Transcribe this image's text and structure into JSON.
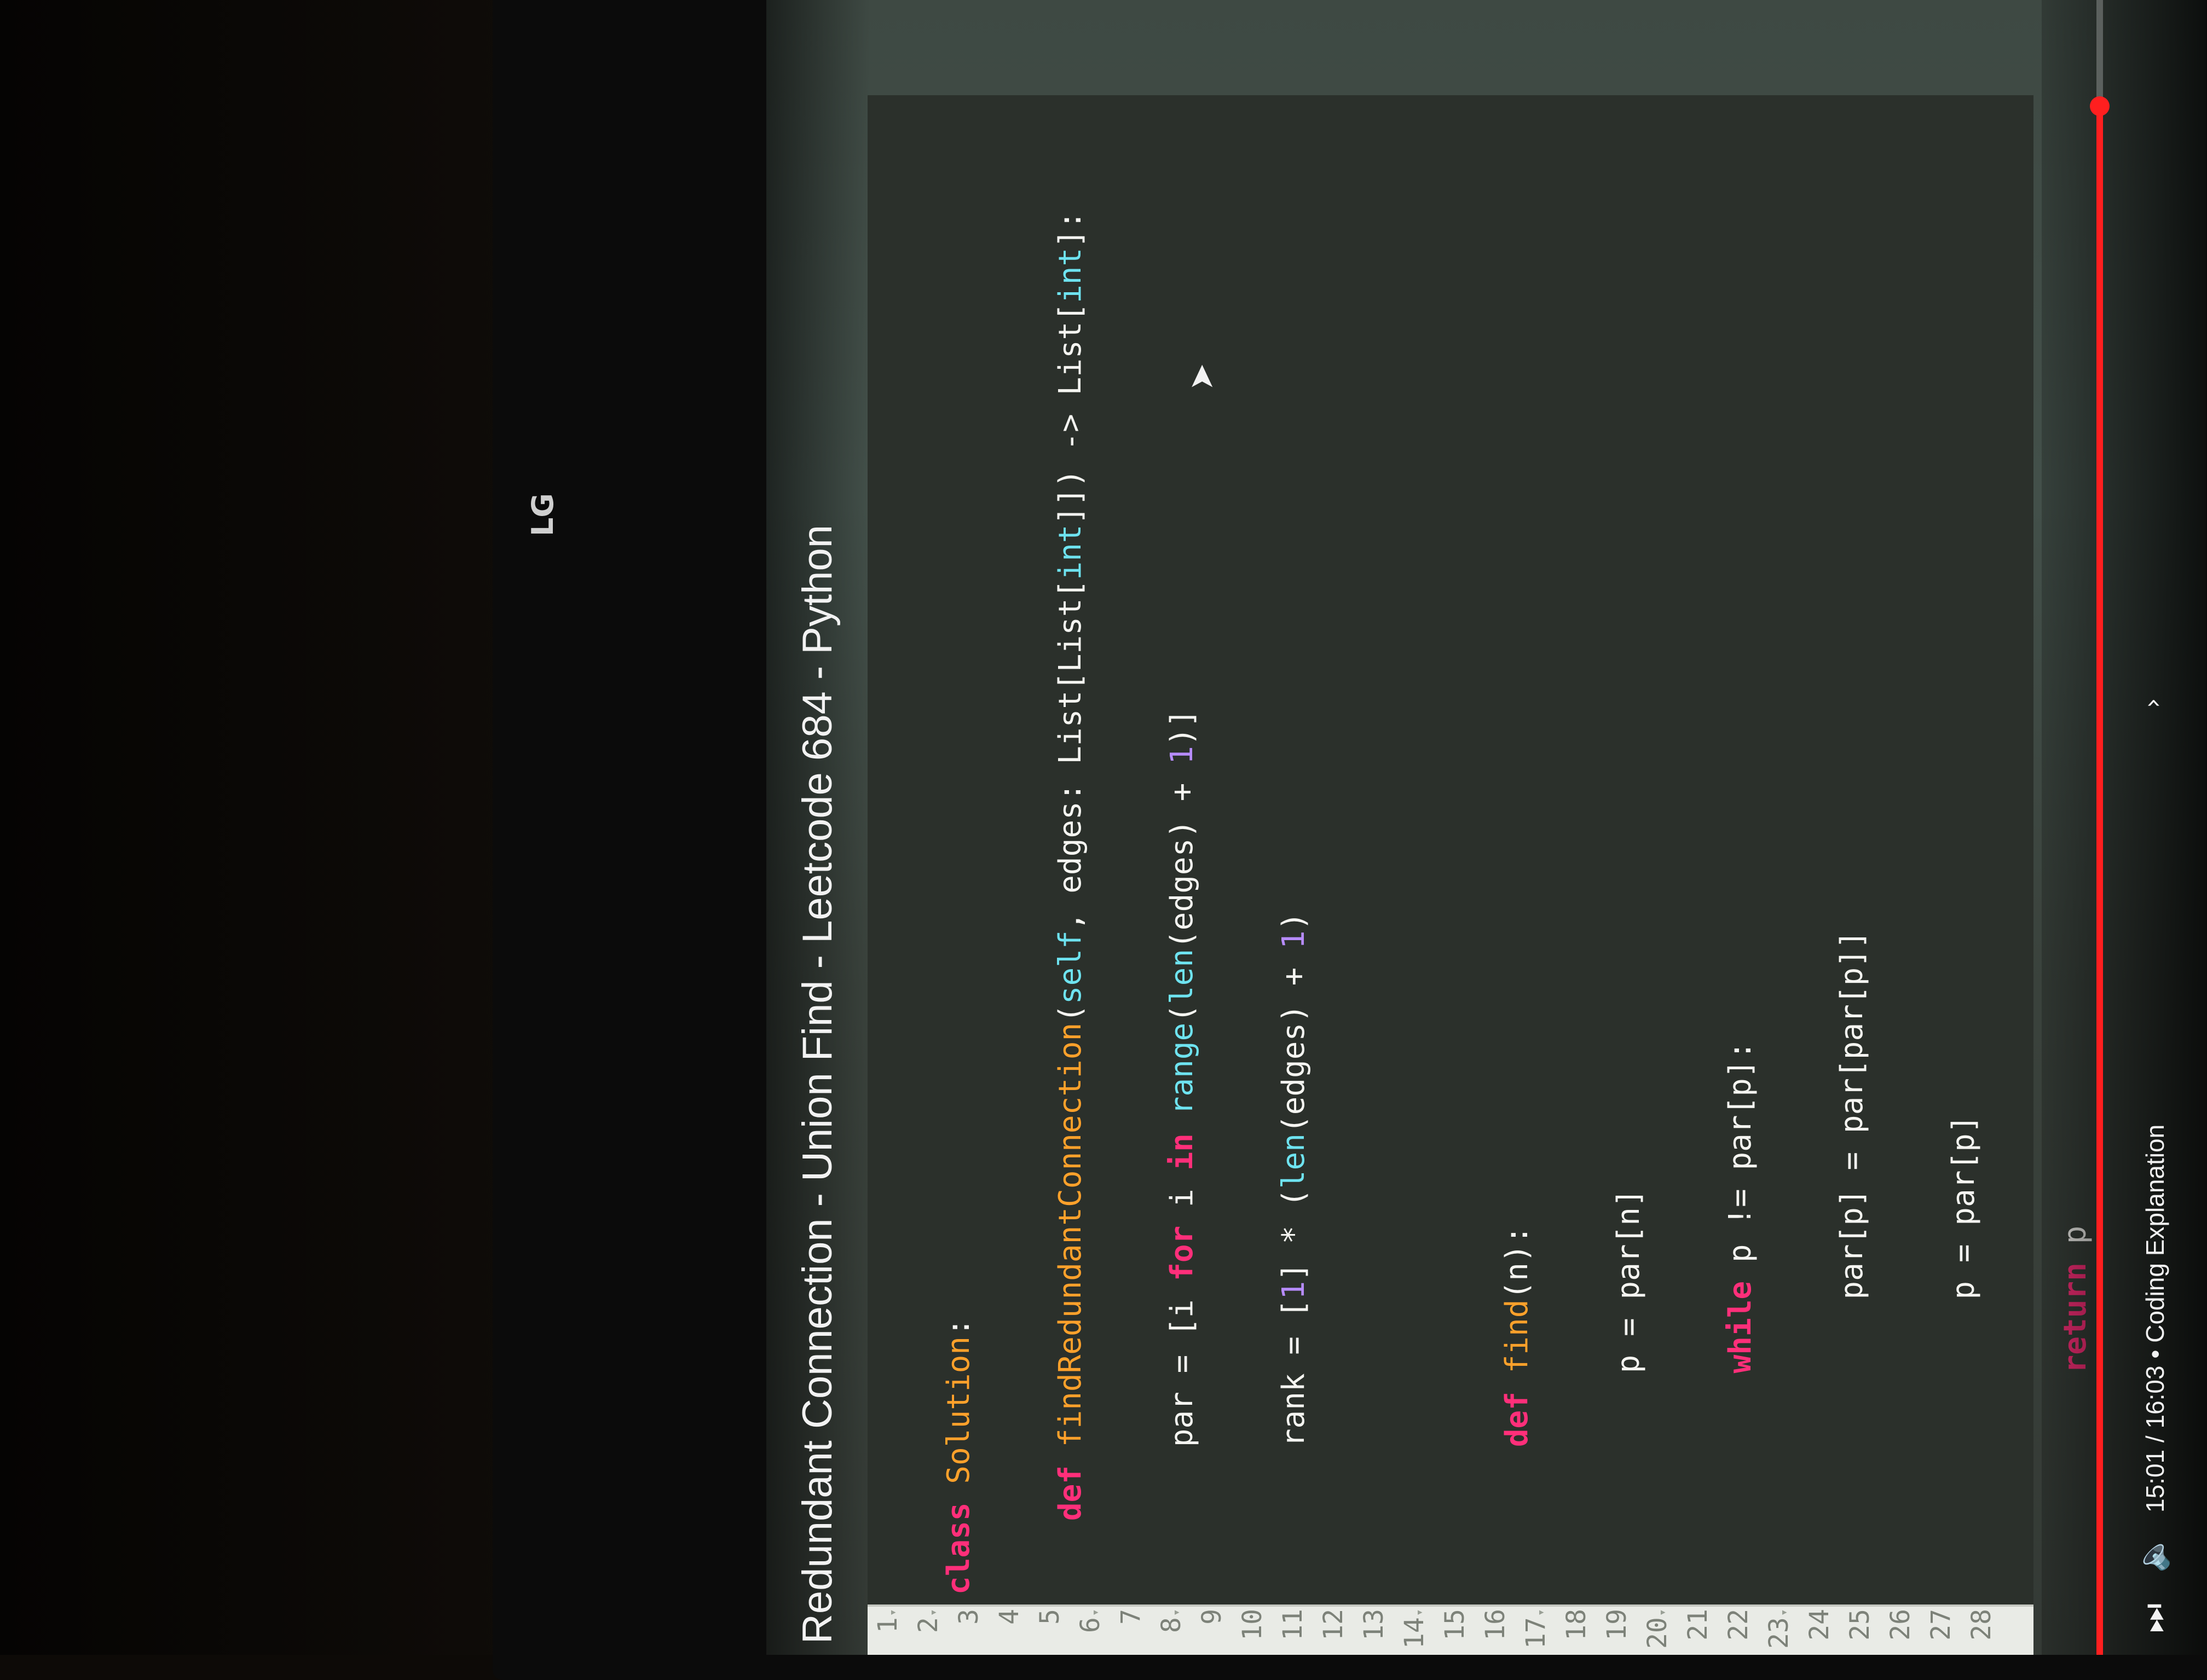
{
  "monitor": {
    "brand": "LG"
  },
  "video": {
    "title": "Redundant Connection - Union Find - Leetcode 684 - Python",
    "time_text": "15:01 / 16:03 • Coding Explanation",
    "chapter_chevron": "›",
    "progress": 0.936,
    "accent_color": "#ff1f1f"
  },
  "editor": {
    "line_numbers": [
      "1",
      "2",
      "3",
      "4",
      "5",
      "6",
      "7",
      "8",
      "9",
      "10",
      "11",
      "12",
      "13",
      "14",
      "15",
      "16",
      "17",
      "18",
      "19",
      "20",
      "21",
      "22",
      "23",
      "24",
      "25",
      "26",
      "27",
      "28"
    ],
    "fold_markers": [
      "1",
      "2",
      "6",
      "8",
      "14",
      "17",
      "20",
      "23"
    ],
    "colors": {
      "keyword": "#ff2f7a",
      "function": "#ffa12b",
      "builtin": "#6ee3f0",
      "number": "#b78cff",
      "comment": "#9fa49b",
      "text": "#f5f5f1"
    }
  },
  "icons": {
    "next": "next-icon",
    "volume": "volume-icon",
    "pointer": "mouse-pointer-icon",
    "chevron": "chevron-right-icon"
  }
}
